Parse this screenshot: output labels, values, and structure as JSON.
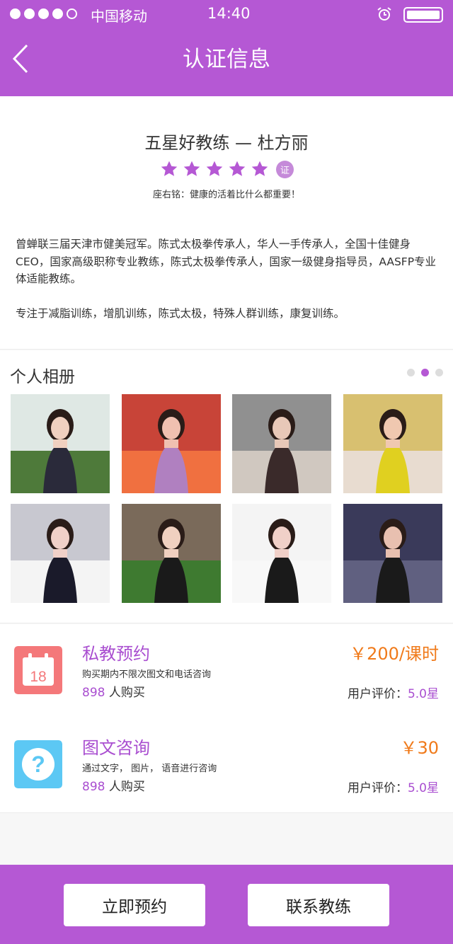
{
  "status_bar": {
    "carrier": "中国移动",
    "time": "14:40",
    "signal_dots": [
      "full",
      "full",
      "full",
      "full",
      "empty"
    ],
    "battery_level": 1.0
  },
  "nav": {
    "title": "认证信息",
    "back_icon": "chevron-left-icon"
  },
  "profile": {
    "title": "五星好教练 — 杜方丽",
    "rating_stars": 5,
    "certified_badge": "证",
    "motto": "座右铭：健康的活着比什么都重要！",
    "bio": [
      "曾蝉联三届天津市健美冠军。陈式太极拳传承人，华人一手传承人，全国十佳健身CEO，国家高级职称专业教练，陈式太极拳传承人，国家一级健身指导员，AASFP专业体适能教练。",
      "专注于减脂训练，增肌训练，陈式太极，特殊人群训练，康复训练。"
    ]
  },
  "album": {
    "title": "个人相册",
    "page_count": 3,
    "current_page": 2,
    "photos": [
      {
        "name": "photo-1",
        "colors": [
          "#dfe8e4",
          "#4e7a3a",
          "#2a2a3a",
          "#f0d0c0"
        ]
      },
      {
        "name": "photo-2",
        "colors": [
          "#c84438",
          "#f07040",
          "#b080c0",
          "#f0c0b0"
        ]
      },
      {
        "name": "photo-3",
        "colors": [
          "#909090",
          "#d0c8c0",
          "#3a2a2a",
          "#e8c8b8"
        ]
      },
      {
        "name": "photo-4",
        "colors": [
          "#d8c070",
          "#e8dcd0",
          "#e0d020",
          "#f0c8b0"
        ]
      },
      {
        "name": "photo-5",
        "colors": [
          "#c8c8d0",
          "#f4f4f4",
          "#1a1a2a",
          "#f0d0c8"
        ]
      },
      {
        "name": "photo-6",
        "colors": [
          "#7a6a5a",
          "#3e7a30",
          "#1a1a1a",
          "#f0d0c0"
        ]
      },
      {
        "name": "photo-7",
        "colors": [
          "#f4f4f4",
          "#f8f8f8",
          "#1a1a1a",
          "#f0d0c8"
        ]
      },
      {
        "name": "photo-8",
        "colors": [
          "#3a3a5a",
          "#606080",
          "#1a1a1a",
          "#e8c0b0"
        ]
      }
    ]
  },
  "services": [
    {
      "name": "私教预约",
      "desc": "购买期内不限次图文和电话咨询",
      "buyers_count": "898",
      "buyers_suffix": " 人购买",
      "price": "￥200/课时",
      "rating_label": "用户评价：",
      "rating_value": "5.0星",
      "icon": "calendar-icon",
      "icon_text": "18",
      "icon_color": "#f4787a"
    },
    {
      "name": "图文咨询",
      "desc": "通过文字，  图片，  语音进行咨询",
      "buyers_count": "898",
      "buyers_suffix": " 人购买",
      "price": "￥30",
      "rating_label": "用户评价：",
      "rating_value": "5.0星",
      "icon": "question-icon",
      "icon_text": "?",
      "icon_color": "#5cc8f4"
    }
  ],
  "footer": {
    "book_label": "立即预约",
    "contact_label": "联系教练"
  },
  "colors": {
    "brand": "#b558d4",
    "price": "#f07a1a",
    "accent_text": "#a94ed0"
  }
}
